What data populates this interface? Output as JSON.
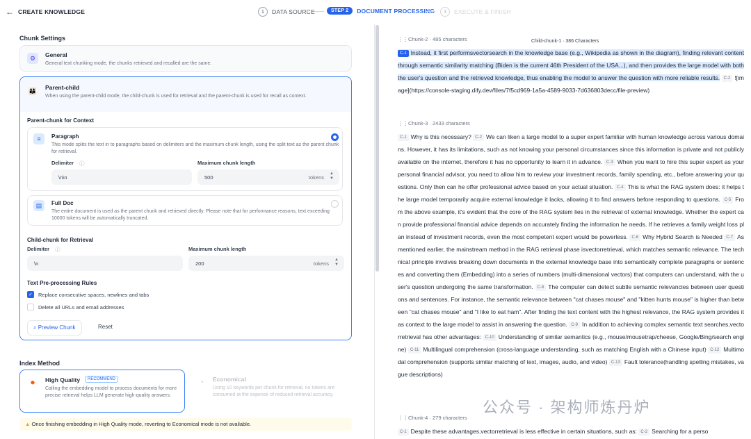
{
  "header": {
    "back_icon": "←",
    "title": "CREATE KNOWLEDGE",
    "steps": [
      {
        "num": "1",
        "label": "DATA SOURCE"
      },
      {
        "num": "STEP 2",
        "label": "DOCUMENT PROCESSING"
      },
      {
        "num": "3",
        "label": "EXECUTE & FINISH"
      }
    ]
  },
  "chunk_settings": {
    "title": "Chunk Settings",
    "general": {
      "title": "General",
      "desc": "General text chunking mode, the chunks retrieved and recalled are the same."
    },
    "parent_child": {
      "title": "Parent-child",
      "desc": "When using the parent-child mode, the child-chunk is used for retrieval and the parent-chunk is used for recall as context.",
      "parent_title": "Parent-chunk for Context",
      "paragraph": {
        "title": "Paragraph",
        "desc": "This mode splits the text in to paragraphs based on delimiters and the maximum chunk length, using the split text as the parent chunk for retrieval.",
        "delimiter_label": "Delimiter",
        "delimiter_value": "\\n\\n",
        "max_label": "Maximum chunk length",
        "max_value": "500",
        "unit": "tokens"
      },
      "fulldoc": {
        "title": "Full Doc",
        "desc": "The entire document is used as the parent chunk and retrieved directly. Please note that for performance reasons, text exceeding 10000 tokens will be automatically truncated."
      },
      "child_title": "Child-chunk for Retrieval",
      "child_delim_label": "Delimiter",
      "child_delim_value": "\\n",
      "child_max_label": "Maximum chunk length",
      "child_max_value": "200",
      "child_unit": "tokens",
      "rules_title": "Text Pre-processing Rules",
      "rule1": "Replace consecutive spaces, newlines and tabs",
      "rule2": "Delete all URLs and email addresses",
      "preview_label": "Preview Chunk",
      "reset_label": "Reset"
    }
  },
  "index": {
    "title": "Index Method",
    "high": {
      "title": "High Quality",
      "badge": "RECOMMEND",
      "desc": "Calling the embedding model to process documents for more precise retrieval helps LLM generate high-quality answers."
    },
    "eco": {
      "title": "Economical",
      "desc": "Using 10 keywords per chunk for retrieval, no tokens are consumed at the expense of reduced retrieval accuracy."
    },
    "warning": "Once finishing embedding in High Quality mode, reverting to Economical mode is not available."
  },
  "preview": {
    "tooltip": "Child-chunk-1 · 386 Characters",
    "c2_head": "Chunk-2 · 485 characters",
    "c2_tag1": "C-1",
    "c2_text1": "Instead, it first performsvectorsearch in the knowledge base (e.g., Wikipedia as shown in the diagram), finding relevant content through semantic similarity matching (Biden is the current 46th President of the USA...), and then provides the large model with both the user's question and the retrieved knowledge, thus enabling the model to answer the question with more reliable results.",
    "c2_tag2": "C-2",
    "c2_text2": "![image](https://console-staging.dify.dev/files/7f5cd969-1a5a-4589-9033-7d636803decc/file-preview)",
    "c3_head": "Chunk-3 · 2433 characters",
    "c3_tags": [
      "C-1",
      "C-2",
      "C-3",
      "C-4",
      "C-5",
      "C-6",
      "C-7",
      "C-8",
      "C-9",
      "C-10",
      "C-11",
      "C-12",
      "C-13"
    ],
    "c3_texts": [
      "Why is this necessary?",
      "We can liken a large model to a super expert familiar with human knowledge across various domains. However, it has its limitations, such as not knowing your personal circumstances since this information is private and not publicly available on the internet, therefore it has no opportunity to learn it in advance.",
      "When you want to hire this super expert as your personal financial advisor, you need to allow him to review your investment records, family spending, etc., before answering your questions. Only then can he offer professional advice based on your actual situation.",
      "This is what the RAG system does: it helps the large model temporarily acquire external knowledge it lacks, allowing it to find answers before responding to questions.",
      "From the above example, it's evident that the core of the RAG system lies in the retrieval of external knowledge. Whether the expert can provide professional financial advice depends on accurately finding the information he needs. If he retrieves a family weight loss plan instead of investment records, even the most competent expert would be powerless.",
      "Why Hybrid Search is Needed",
      "As mentioned earlier, the mainstream method in the RAG retrieval phase isvectorretrieval, which matches semantic relevance. The technical principle involves breaking down documents in the external knowledge base into semantically complete paragraphs or sentences and converting them (Embedding) into a series of numbers (multi-dimensional vectors) that computers can understand, with the user's question undergoing the same transformation.",
      "The computer can detect subtle semantic relevancies between user questions and sentences. For instance, the semantic relevance between \"cat chases mouse\" and \"kitten hunts mouse\" is higher than between \"cat chases mouse\" and \"I like to eat ham\". After finding the text content with the highest relevance, the RAG system provides it as context to the large model to assist in answering the question.",
      "In addition to achieving complex semantic text searches,vectorretrieval has other advantages:",
      "Understanding of similar semantics (e.g., mouse/mousetrap/cheese, Google/Bing/search engine)",
      "Multilingual comprehension (cross-language understanding, such as matching English with a Chinese input)",
      "Multimodal comprehension (supports similar matching of text, images, audio, and video)",
      "Fault tolerance(handling spelling mistakes, vague descriptions)"
    ],
    "c4_head": "Chunk-4 · 279 characters",
    "c4_tag1": "C-1",
    "c4_text1": "Despite these advantages,vectorretrieval is less effective in certain situations, such as:",
    "c4_tag2": "C-2",
    "c4_text2": "Searching for a perso"
  },
  "watermark": "公众号 · 架构师炼丹炉"
}
